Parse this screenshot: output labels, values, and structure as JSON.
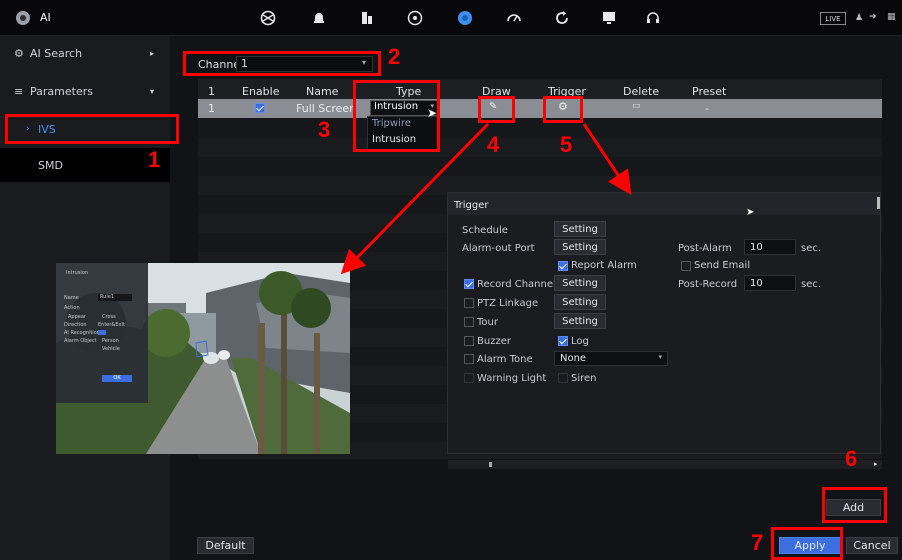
{
  "topbar": {
    "title": "AI",
    "icons": [
      "aperture-icon",
      "bell-icon",
      "storage-icon",
      "globe-icon",
      "ai-icon",
      "speedometer-icon",
      "refresh-icon",
      "monitor-icon",
      "headset-icon"
    ],
    "live_label": "LIVE"
  },
  "sidebar": {
    "items": [
      {
        "label": "AI Search"
      },
      {
        "label": "Parameters"
      },
      {
        "label": "IVS"
      },
      {
        "label": "SMD"
      }
    ]
  },
  "channel": {
    "label": "Channel",
    "value": "1"
  },
  "table": {
    "headers": [
      "",
      "Enable",
      "Name",
      "Type",
      "Draw",
      "Trigger",
      "Delete",
      "Preset"
    ],
    "row": {
      "index": "1",
      "name": "Full Screen",
      "type": "Intrusion",
      "preset": "-"
    },
    "type_options": [
      "Tripwire",
      "Intrusion"
    ]
  },
  "trigger": {
    "title": "Trigger",
    "schedule": "Schedule",
    "alarm_out": "Alarm-out Port",
    "setting": "Setting",
    "post_alarm": "Post-Alarm",
    "post_alarm_value": "10",
    "sec": "sec.",
    "report_alarm": "Report Alarm",
    "send_email": "Send Email",
    "record_channel": "Record Channel",
    "post_record": "Post-Record",
    "post_record_value": "10",
    "ptz": "PTZ Linkage",
    "tour": "Tour",
    "buzzer": "Buzzer",
    "log": "Log",
    "alarm_tone": "Alarm Tone",
    "alarm_tone_value": "None",
    "warning_light": "Warning Light",
    "siren": "Siren"
  },
  "draw_preview": {
    "panel_title": "Intrusion",
    "name_label": "Name",
    "name_value": "Rule1",
    "action_label": "Action",
    "appear": "Appear",
    "cross": "Cross",
    "direction_label": "Direction",
    "direction_value": "Enter&Exit",
    "ai_recog": "AI Recognition",
    "alarm_obj": "Alarm Object",
    "person": "Person",
    "vehicle": "Vehicle",
    "ok": "OK"
  },
  "footer": {
    "default": "Default",
    "add": "Add",
    "apply": "Apply",
    "cancel": "Cancel"
  },
  "annotations": [
    "1",
    "2",
    "3",
    "4",
    "5",
    "6",
    "7"
  ],
  "colors": {
    "accent": "#3d6ee0",
    "annotation": "#ff0000",
    "selected_row": "#8a8d93"
  }
}
